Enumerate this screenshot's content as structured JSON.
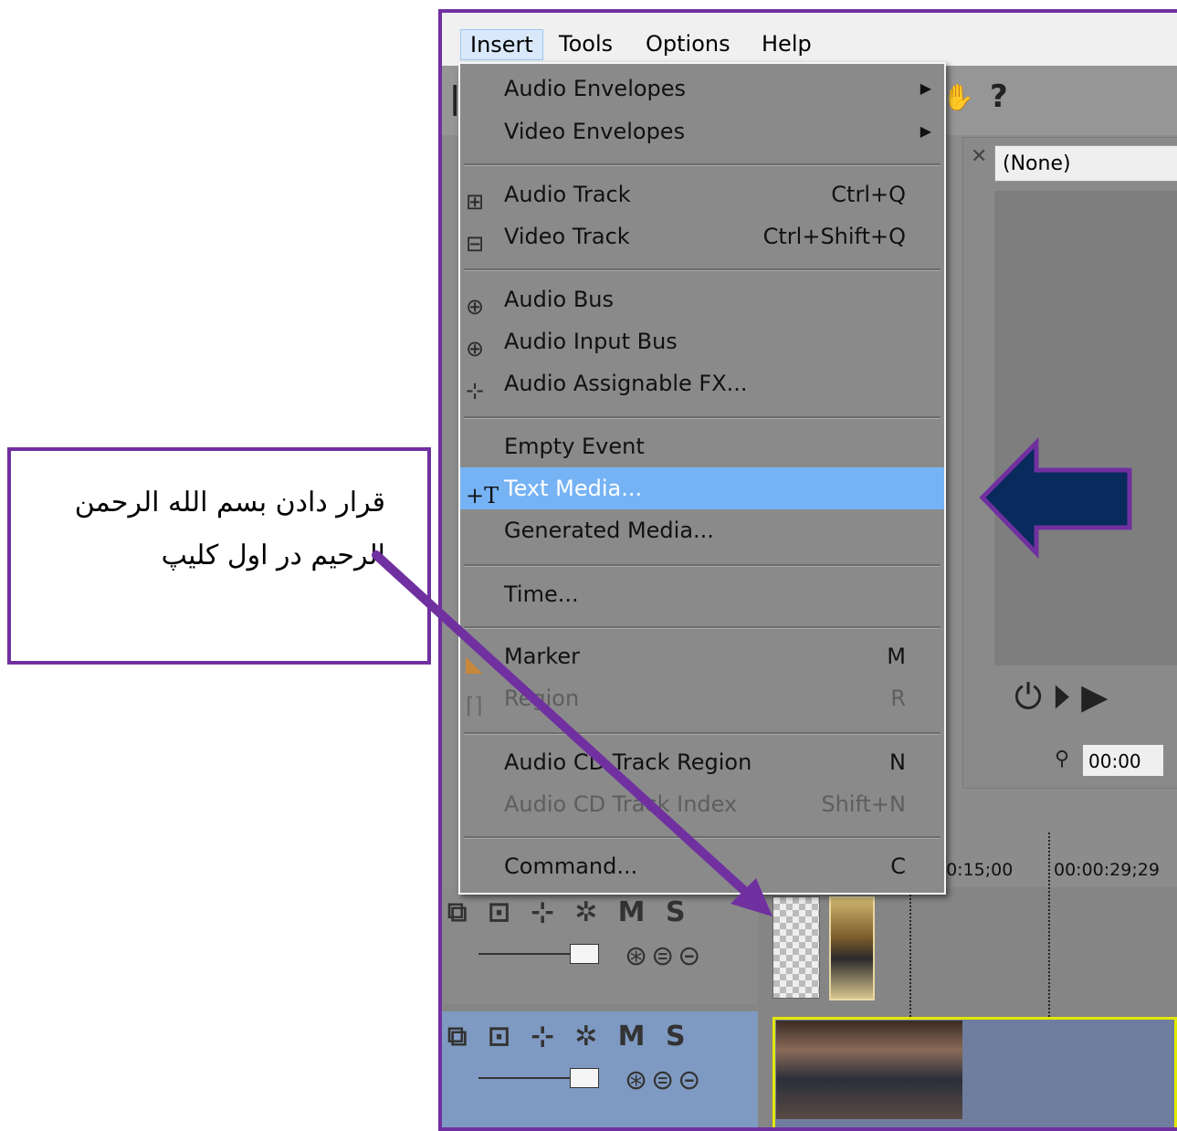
{
  "menubar": {
    "items": [
      "Insert",
      "Tools",
      "Options",
      "Help"
    ]
  },
  "toolbar": {
    "help_icon": "?"
  },
  "preview": {
    "preset": "(None)",
    "timecode": "00:00"
  },
  "ruler": {
    "t1": "00:15;00",
    "t2": "00:00:29;29"
  },
  "tracks": {
    "mute_label": "M",
    "solo_label": "S"
  },
  "insert_menu": {
    "audio_envelopes": "Audio Envelopes",
    "video_envelopes": "Video Envelopes",
    "audio_track": "Audio Track",
    "audio_track_sc": "Ctrl+Q",
    "video_track": "Video Track",
    "video_track_sc": "Ctrl+Shift+Q",
    "audio_bus": "Audio Bus",
    "audio_input_bus": "Audio Input Bus",
    "audio_assignable_fx": "Audio Assignable FX...",
    "empty_event": "Empty Event",
    "text_media": "Text Media...",
    "generated_media": "Generated Media...",
    "time": "Time...",
    "marker": "Marker",
    "marker_sc": "M",
    "region": "Region",
    "region_sc": "R",
    "cd_track_region": "Audio CD Track Region",
    "cd_track_region_sc": "N",
    "cd_track_index": "Audio CD Track Index",
    "cd_track_index_sc": "Shift+N",
    "command": "Command...",
    "command_sc": "C"
  },
  "callout": {
    "line1": "قرار دادن بسم الله الرحمن",
    "line2": "الرحیم در اول کلیپ"
  },
  "colors": {
    "accent": "#7030a0",
    "highlight": "#76b3f5",
    "arrow_fill": "#082a5c"
  },
  "icons": [
    "submenu-arrow-icon",
    "audio-track-icon",
    "video-track-icon",
    "audio-bus-icon",
    "audio-input-bus-icon",
    "fx-icon",
    "text-media-icon",
    "marker-icon",
    "region-icon",
    "left-arrow-icon",
    "pointer-arrow-icon",
    "help-icon",
    "loop-icon",
    "play-icon",
    "close-icon"
  ]
}
